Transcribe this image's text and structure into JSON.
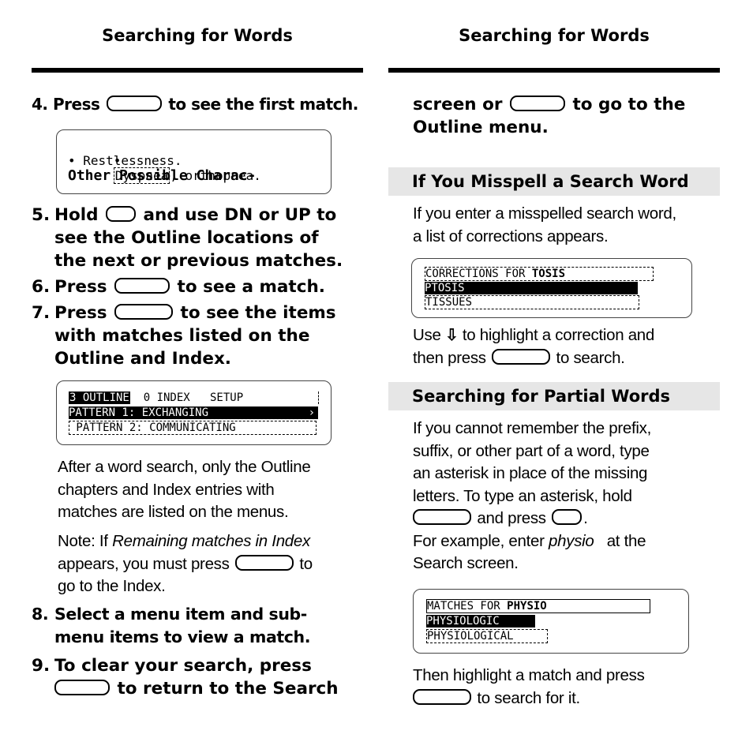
{
  "left_column": {
    "running_head": "Searching for Words",
    "step4": {
      "num": "4.",
      "pre": "Press",
      "post": "to see the first match."
    },
    "screen1": {
      "line1_bullet": "•",
      "line1_highlight": "Dyspnea",
      "line1_rest": ", orthopnea.",
      "line2": "• Restlessness.",
      "line3": "Other Possible Charac-"
    },
    "step5": {
      "num": "5.",
      "pre": "Hold",
      "post": "and use DN or UP to",
      "line2": "see the Outline locations of",
      "line3": "the next or previous matches."
    },
    "step6": {
      "num": "6.",
      "pre": "Press",
      "post": "to see a match."
    },
    "step7": {
      "num": "7.",
      "pre": "Press",
      "post": "to see the items",
      "line2": "with matches listed on the",
      "line3": "Outline and Index."
    },
    "screen2": {
      "row1_highlight": "3 OUTLINE",
      "row1_rest": "  0 INDEX   SETUP",
      "row2": "PATTERN 1: EXCHANGING",
      "row3": " PATTERN 2: COMMUNICATING"
    },
    "para1": [
      "After a word search, only the Outline",
      "chapters and Index entries with",
      "matches are listed on the menus."
    ],
    "note": {
      "prefix": "Note: If ",
      "italic": "Remaining matches in Index",
      "line2_pre": "appears, you must press",
      "line2_post": "to",
      "line3": "go to the Index."
    },
    "step8": {
      "num": "8.",
      "line1": "Select a menu item and sub-",
      "line2": "menu items to view a match."
    },
    "step9": {
      "num": "9.",
      "line1": "To clear your search, press",
      "line2_post": "to return to the Search"
    }
  },
  "right_column": {
    "running_head": "Searching for Words",
    "continued": {
      "line1_pre": "screen or",
      "line1_post": "to go to the",
      "line2": "Outline menu."
    },
    "section1": {
      "title": "If You Misspell a Search Word",
      "para": [
        "If you enter a misspelled search word,",
        "a list of corrections appears."
      ],
      "screen": {
        "header": "CORRECTIONS FOR ",
        "header_bold": "TOSIS",
        "item1": "PTOSIS",
        "item2": "TISSUES"
      },
      "after": {
        "pre": "Use",
        "arrow_icon": "down-arrow-key",
        "post": "to highlight a correction and",
        "line2_pre": "then press",
        "line2_post": "to search."
      }
    },
    "section2": {
      "title": "Searching for Partial Words",
      "para": [
        "If you cannot remember the prefix,",
        "suffix, or other part of a word, type",
        "an asterisk in place of the missing",
        "letters. To type an asterisk, hold"
      ],
      "para_last": {
        "mid": "and press",
        "end": "."
      },
      "example": {
        "pre": "For example, enter ",
        "italic": "physio",
        "post": "   at the",
        "line2": "Search screen."
      },
      "screen": {
        "header": "MATCHES FOR ",
        "header_bold": "PHYSIO",
        "item1": "PHYSIOLOGIC",
        "item2": "PHYSIOLOGICAL"
      },
      "after": {
        "line1": "Then highlight a match and press",
        "line2_post": "to search for it."
      }
    }
  }
}
